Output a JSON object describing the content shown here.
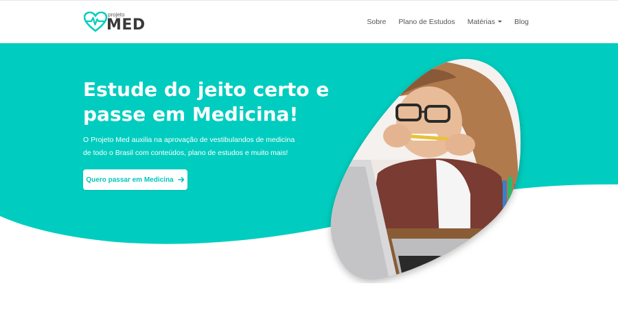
{
  "brand": {
    "small": "projeto",
    "big": "MED"
  },
  "nav": {
    "links": [
      {
        "label": "Sobre"
      },
      {
        "label": "Plano de Estudos"
      },
      {
        "label": "Matérias"
      },
      {
        "label": "Blog"
      }
    ]
  },
  "hero": {
    "title": "Estude do jeito certo e passe em Medicina!",
    "text": "O Projeto Med auxilia na aprovação de vestibulandos de medicina de todo o Brasil com conteúdos, plano de estudos e muito mais!",
    "cta_label": "Quero passar em Medicina"
  },
  "colors": {
    "accent": "#00cdbf",
    "text_dark": "#3a3a3a"
  },
  "icons": {
    "logo": "heart-pulse-icon",
    "cta": "arrow-right-icon",
    "dropdown": "caret-down-icon"
  }
}
